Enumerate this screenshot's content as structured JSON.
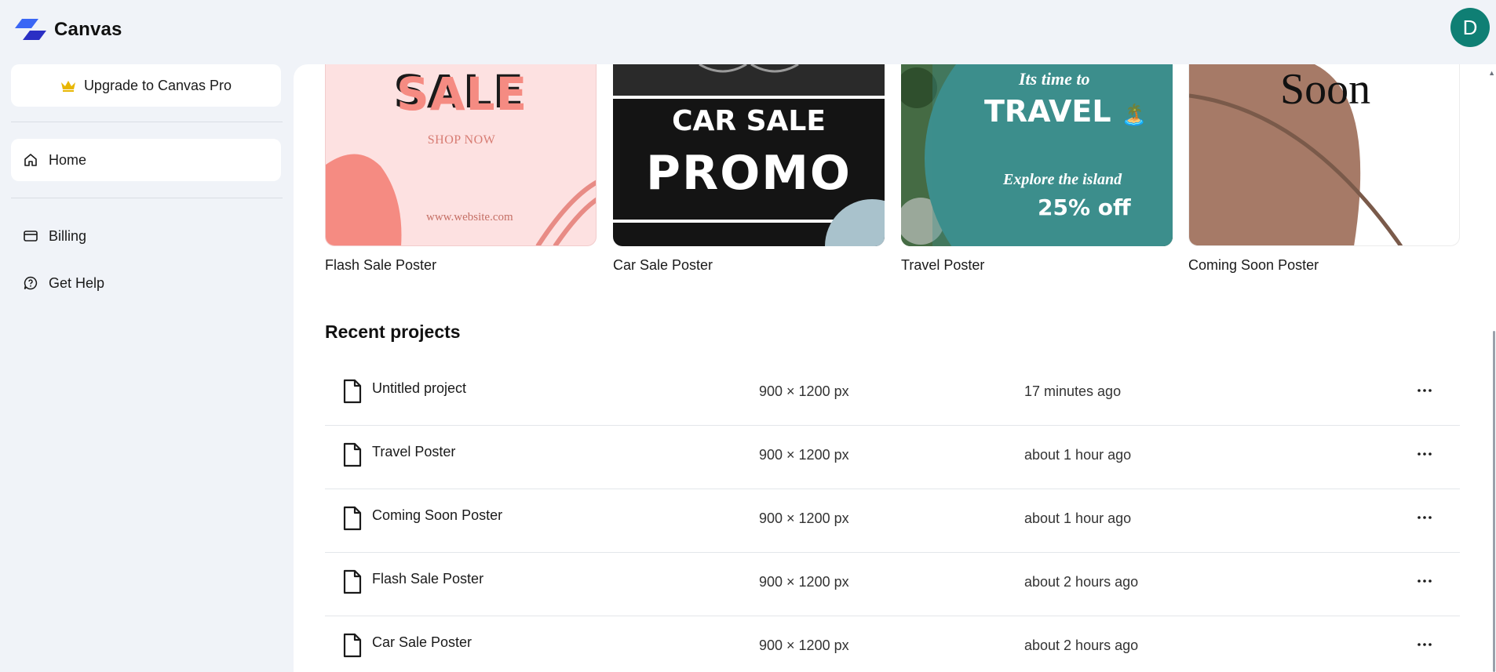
{
  "app": {
    "title": "Canvas",
    "avatar_initial": "D",
    "brand_color": "#3451e6",
    "avatar_color": "#0f7f74"
  },
  "sidebar": {
    "upgrade_label": "Upgrade to Canvas Pro",
    "items": [
      {
        "label": "Home",
        "icon": "home-icon",
        "active": true
      },
      {
        "label": "Billing",
        "icon": "credit-card-icon",
        "active": false
      },
      {
        "label": "Get Help",
        "icon": "help-chat-icon",
        "active": false
      }
    ]
  },
  "templates": [
    {
      "name": "Flash Sale Poster",
      "art": {
        "headline": "SALE",
        "sub": "SHOP NOW",
        "footer": "www.website.com"
      }
    },
    {
      "name": "Car Sale Poster",
      "art": {
        "line1": "CAR SALE",
        "line2": "PROMO"
      }
    },
    {
      "name": "Travel Poster",
      "art": {
        "line1": "Its time to",
        "line2": "TRAVEL",
        "emoji": "🏝️",
        "line3": "Explore the island",
        "line4": "25% off"
      }
    },
    {
      "name": "Coming Soon Poster",
      "art": {
        "headline": "Soon"
      }
    }
  ],
  "recent": {
    "title": "Recent projects",
    "projects": [
      {
        "name": "Untitled project",
        "dims": "900 × 1200 px",
        "updated": "17 minutes ago"
      },
      {
        "name": "Travel Poster",
        "dims": "900 × 1200 px",
        "updated": "about 1 hour ago"
      },
      {
        "name": "Coming Soon Poster",
        "dims": "900 × 1200 px",
        "updated": "about 1 hour ago"
      },
      {
        "name": "Flash Sale Poster",
        "dims": "900 × 1200 px",
        "updated": "about 2 hours ago"
      },
      {
        "name": "Car Sale Poster",
        "dims": "900 × 1200 px",
        "updated": "about 2 hours ago"
      }
    ]
  }
}
